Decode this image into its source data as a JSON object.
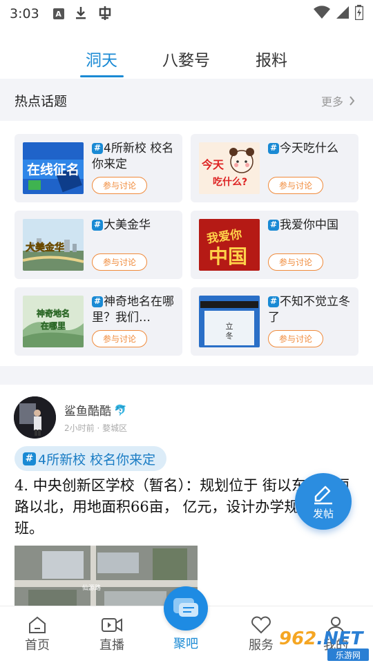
{
  "status_bar": {
    "time": "3:03",
    "icons": [
      "a-icon",
      "download-icon",
      "bug-icon",
      "wifi-icon",
      "signal-icon",
      "battery-icon"
    ]
  },
  "top_tabs": [
    {
      "label": "洞天",
      "active": true
    },
    {
      "label": "八婺号",
      "active": false
    },
    {
      "label": "报料",
      "active": false
    }
  ],
  "hot_topics": {
    "title": "热点话题",
    "more_label": "更多",
    "hash_symbol": "#",
    "join_label": "参与讨论",
    "items": [
      {
        "title": "4所新校 校名你来定",
        "thumb_text": "在线征名"
      },
      {
        "title": "今天吃什么",
        "thumb_text": "今天吃什么?"
      },
      {
        "title": "大美金华",
        "thumb_text": "大美金华"
      },
      {
        "title": "我爱你中国",
        "thumb_text": "我爱你中国"
      },
      {
        "title": "神奇地名在哪里？我们…",
        "thumb_text": "神奇地名在哪里"
      },
      {
        "title": "不知不觉立冬了",
        "thumb_text": "立冬"
      }
    ]
  },
  "post": {
    "author": "鲨鱼酷酷",
    "author_emoji": "🐬",
    "meta": "2小时前 · 婺城区",
    "topic": "4所新校 校名你来定",
    "body": "4. 中央创新区学校（暂名）：规划位于 街以东、神丽路以北，用地面积66亩， 亿元，设计办学规模48个班。",
    "image_road_label": "仙源路"
  },
  "fab": {
    "label": "发帖"
  },
  "bottom_nav": {
    "items": [
      {
        "label": "首页"
      },
      {
        "label": "直播"
      },
      {
        "label": "聚吧",
        "active": true
      },
      {
        "label": "服务"
      },
      {
        "label": "我的"
      }
    ]
  },
  "watermark": {
    "text": "962",
    "net": ".NET",
    "sub": "乐游网"
  },
  "colors": {
    "accent": "#1a8ad4",
    "join_orange": "#f08a3a",
    "section_bg": "#f3f4f8"
  }
}
